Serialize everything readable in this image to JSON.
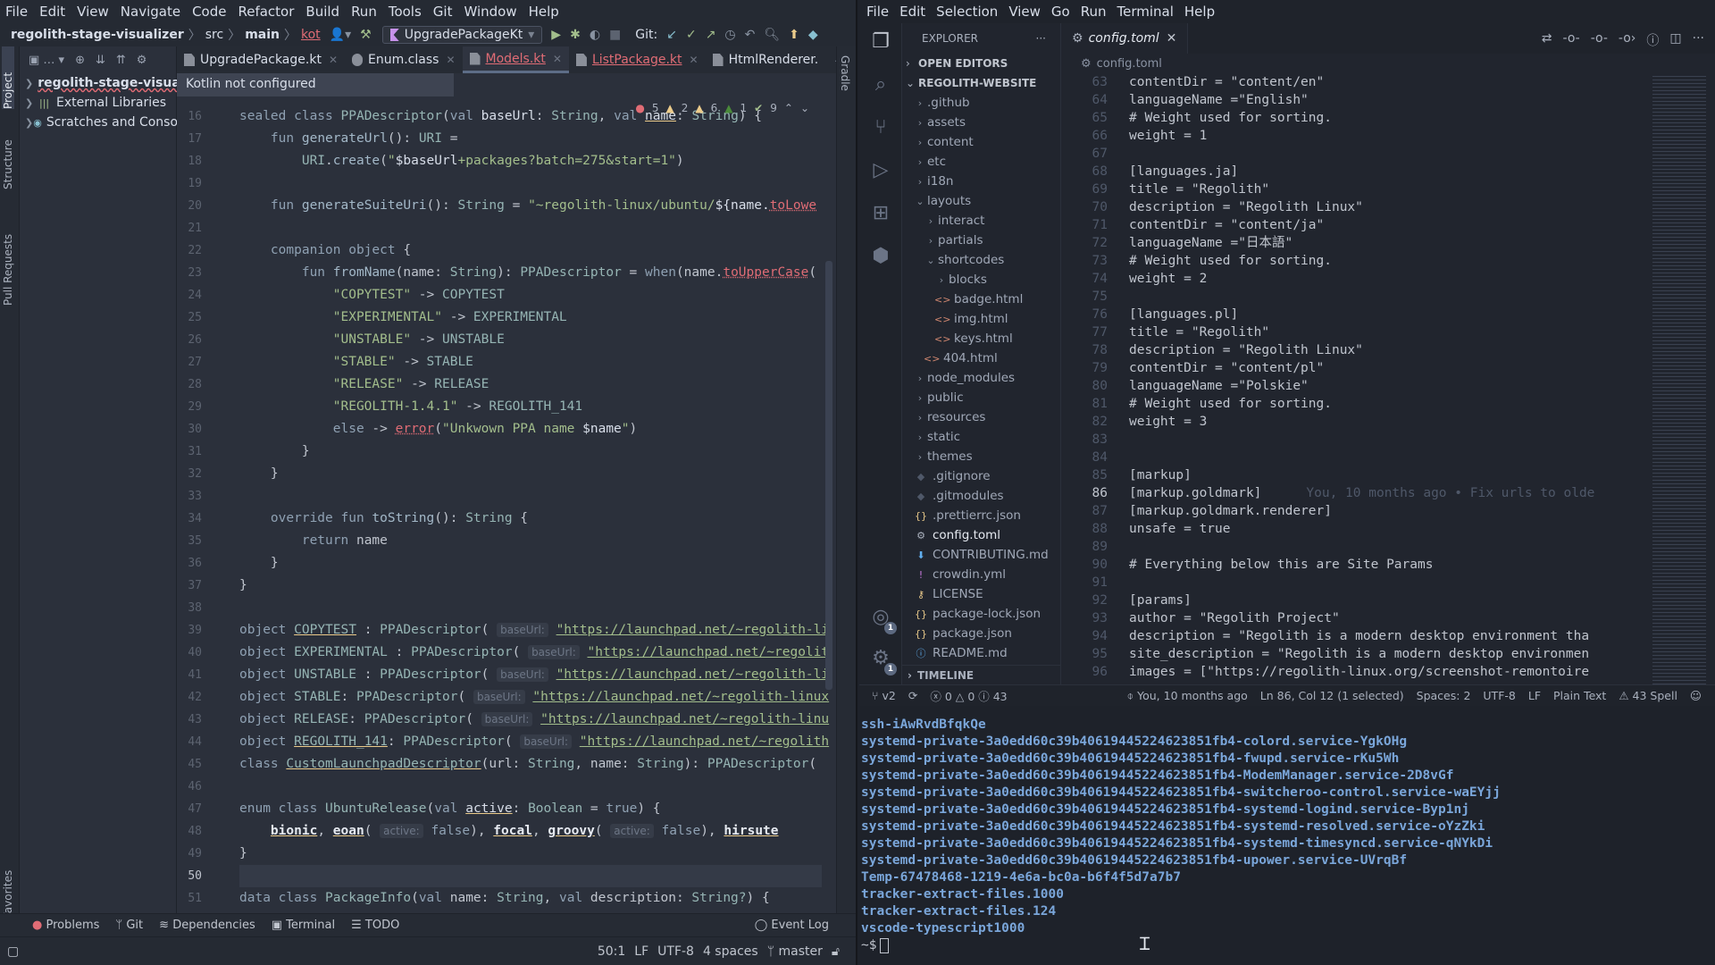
{
  "intellij": {
    "menu": [
      "File",
      "Edit",
      "View",
      "Navigate",
      "Code",
      "Refactor",
      "Build",
      "Run",
      "Tools",
      "Git",
      "Window",
      "Help"
    ],
    "breadcrumb": {
      "project": "regolith-stage-visualizer",
      "src": "src",
      "main": "main",
      "kot": "kot"
    },
    "run_config": "UpgradePackageKt",
    "git_label": "Git:",
    "left_tool_tabs": [
      "Project",
      "Structure",
      "Pull Requests",
      "Favorites"
    ],
    "right_tool_tabs": [
      "Gradle"
    ],
    "project_tree": [
      {
        "label": "regolith-stage-visualizer",
        "type": "module"
      },
      {
        "label": "External Libraries",
        "type": "libraries"
      },
      {
        "label": "Scratches and Consoles",
        "type": "scratches"
      }
    ],
    "tabs": [
      {
        "label": "UpgradePackage.kt",
        "error": false,
        "active": false
      },
      {
        "label": "Enum.class",
        "error": false,
        "active": false
      },
      {
        "label": "Models.kt",
        "error": true,
        "active": true
      },
      {
        "label": "ListPackage.kt",
        "error": true,
        "active": false
      },
      {
        "label": "HtmlRenderer.",
        "error": false,
        "active": false
      }
    ],
    "tooltip": "Kotlin not configured",
    "inspections": {
      "errors": "5",
      "warnings": "2",
      "weak_warnings": "6",
      "typos": "1",
      "ok": "9"
    },
    "code_lines": [
      {
        "n": "16",
        "html": "<span class='kw'>sealed class</span> <span class='ty'>PPADescriptor</span>(<span class='kw'>val</span> <span class='nm'>baseUrl</span>: <span class='ty'>String</span>, <span class='kw'>val</span> <span class='nm yu'>name</span>: <span class='ty'>String</span>) {"
      },
      {
        "n": "17",
        "html": "    <span class='kw'>fun</span> <span class='fn'>generateUrl</span>(): <span class='ty'>URI</span> ="
      },
      {
        "n": "18",
        "html": "        <span class='ty'>URI</span>.<span class='fn'>create</span>(<span class='st'>\"</span><span class='nm'>$baseUrl</span><span class='st'>+packages?batch=275&amp;start=1\"</span>)"
      },
      {
        "n": "19",
        "html": ""
      },
      {
        "n": "20",
        "html": "    <span class='kw'>fun</span> <span class='fn'>generateSuiteUri</span>(): <span class='ty'>String</span> = <span class='st'>\"~regolith-linux/ubuntu/</span><span class='nm'>${name.</span><span class='redu'>toLowe</span>"
      },
      {
        "n": "21",
        "html": ""
      },
      {
        "n": "22",
        "html": "    <span class='kw'>companion object</span> {"
      },
      {
        "n": "23",
        "html": "        <span class='kw'>fun</span> <span class='fn'>fromName</span>(name: <span class='ty'>String</span>): <span class='ty'>PPADescriptor</span> = <span class='kw'>when</span>(name.<span class='redu'>toUpperCase</span>("
      },
      {
        "n": "24",
        "html": "            <span class='st'>\"COPYTEST\"</span> -&gt; <span class='ty'>COPYTEST</span>"
      },
      {
        "n": "25",
        "html": "            <span class='st'>\"EXPERIMENTAL\"</span> -&gt; <span class='ty'>EXPERIMENTAL</span>"
      },
      {
        "n": "26",
        "html": "            <span class='st'>\"UNSTABLE\"</span> -&gt; <span class='ty'>UNSTABLE</span>"
      },
      {
        "n": "27",
        "html": "            <span class='st'>\"STABLE\"</span> -&gt; <span class='ty'>STABLE</span>"
      },
      {
        "n": "28",
        "html": "            <span class='st'>\"RELEASE\"</span> -&gt; <span class='ty'>RELEASE</span>"
      },
      {
        "n": "29",
        "html": "            <span class='st'>\"REGOLITH-1.4.1\"</span> -&gt; <span class='ty'>REGOLITH_141</span>"
      },
      {
        "n": "30",
        "html": "            <span class='kw'>else</span> -&gt; <span class='redu'>error</span>(<span class='st'>\"Unkwown PPA name </span><span class='nm'>$name</span><span class='st'>\"</span>)"
      },
      {
        "n": "31",
        "html": "        }"
      },
      {
        "n": "32",
        "html": "    }"
      },
      {
        "n": "33",
        "html": ""
      },
      {
        "n": "34",
        "html": "    <span class='kw'>override fun</span> <span class='fn'>toString</span>(): <span class='ty'>String</span> {"
      },
      {
        "n": "35",
        "html": "        <span class='kw'>return</span> name"
      },
      {
        "n": "36",
        "html": "    }"
      },
      {
        "n": "37",
        "html": "}"
      },
      {
        "n": "38",
        "html": ""
      },
      {
        "n": "39",
        "html": "<span class='kw'>object</span> <span class='ty yu'>COPYTEST</span> : <span class='ty'>PPADescriptor</span>( <span class='hint'>baseUrl:</span> <span class='url'>\"https://launchpad.net/~regolith-li</span>"
      },
      {
        "n": "40",
        "html": "<span class='kw'>object</span> <span class='ty'>EXPERIMENTAL</span> : <span class='ty'>PPADescriptor</span>( <span class='hint'>baseUrl:</span> <span class='url'>\"https://launchpad.net/~regolit</span>"
      },
      {
        "n": "41",
        "html": "<span class='kw'>object</span> <span class='ty'>UNSTABLE</span> : <span class='ty'>PPADescriptor</span>( <span class='hint'>baseUrl:</span> <span class='url'>\"https://launchpad.net/~regolith-li</span>"
      },
      {
        "n": "42",
        "html": "<span class='kw'>object</span> <span class='ty'>STABLE</span>: <span class='ty'>PPADescriptor</span>( <span class='hint'>baseUrl:</span> <span class='url'>\"https://launchpad.net/~regolith-linux</span>"
      },
      {
        "n": "43",
        "html": "<span class='kw'>object</span> <span class='ty'>RELEASE</span>: <span class='ty'>PPADescriptor</span>( <span class='hint'>baseUrl:</span> <span class='url'>\"https://launchpad.net/~regolith-linu</span>"
      },
      {
        "n": "44",
        "html": "<span class='kw'>object</span> <span class='ty yu'>REGOLITH_141</span>: <span class='ty'>PPADescriptor</span>( <span class='hint'>baseUrl:</span> <span class='url'>\"https://launchpad.net/~regolith</span>"
      },
      {
        "n": "45",
        "html": "<span class='kw'>class</span> <span class='ty yu'>CustomLaunchpadDescriptor</span>(url: <span class='ty'>String</span>, name: <span class='ty'>String</span>): <span class='ty'>PPADescriptor</span>("
      },
      {
        "n": "46",
        "html": ""
      },
      {
        "n": "47",
        "html": "<span class='kw'>enum class</span> <span class='ty'>UbuntuRelease</span>(<span class='kw'>val</span> <span class='nm yu'>active</span>: <span class='ty'>Boolean</span> = <span class='kw'>true</span>) {"
      },
      {
        "n": "48",
        "html": "    <span class='bold yu'>bionic</span>, <span class='bold yu'>eoan</span>( <span class='hint'>active:</span> <span class='kw'>false</span>), <span class='bold yu'>focal</span>, <span class='bold yu'>groovy</span>( <span class='hint'>active:</span> <span class='kw'>false</span>), <span class='bold yu'>hirsute</span>"
      },
      {
        "n": "49",
        "html": "}"
      },
      {
        "n": "50",
        "html": "",
        "current": true
      },
      {
        "n": "51",
        "html": "<span class='kw'>data class</span> <span class='ty'>PackageInfo</span>(<span class='kw'>val</span> name: <span class='ty'>String</span>, <span class='kw'>val</span> description: <span class='ty'>String?</span>) {"
      }
    ],
    "bottom_tools": [
      "Problems",
      "Git",
      "Dependencies",
      "Terminal",
      "TODO"
    ],
    "event_log": "Event Log",
    "status": {
      "position": "50:1",
      "line_sep": "LF",
      "encoding": "UTF-8",
      "indent": "4 spaces",
      "branch": "master"
    }
  },
  "vscode": {
    "menu": [
      "File",
      "Edit",
      "Selection",
      "View",
      "Go",
      "Run",
      "Terminal",
      "Help"
    ],
    "explorer_title": "EXPLORER",
    "open_editors": "OPEN EDITORS",
    "workspace": "REGOLITH-WEBSITE",
    "files": [
      {
        "label": ".github",
        "kind": "folder",
        "depth": 0,
        "open": false
      },
      {
        "label": "assets",
        "kind": "folder",
        "depth": 0,
        "open": false
      },
      {
        "label": "content",
        "kind": "folder",
        "depth": 0,
        "open": false
      },
      {
        "label": "etc",
        "kind": "folder",
        "depth": 0,
        "open": false
      },
      {
        "label": "i18n",
        "kind": "folder",
        "depth": 0,
        "open": false
      },
      {
        "label": "layouts",
        "kind": "folder",
        "depth": 0,
        "open": true
      },
      {
        "label": "interact",
        "kind": "folder",
        "depth": 1,
        "open": false
      },
      {
        "label": "partials",
        "kind": "folder",
        "depth": 1,
        "open": false
      },
      {
        "label": "shortcodes",
        "kind": "folder",
        "depth": 1,
        "open": true
      },
      {
        "label": "blocks",
        "kind": "folder",
        "depth": 2,
        "open": false
      },
      {
        "label": "badge.html",
        "kind": "html",
        "depth": 2
      },
      {
        "label": "img.html",
        "kind": "html",
        "depth": 2
      },
      {
        "label": "keys.html",
        "kind": "html",
        "depth": 2
      },
      {
        "label": "404.html",
        "kind": "html",
        "depth": 1
      },
      {
        "label": "node_modules",
        "kind": "folder",
        "depth": 0,
        "open": false
      },
      {
        "label": "public",
        "kind": "folder",
        "depth": 0,
        "open": false
      },
      {
        "label": "resources",
        "kind": "folder",
        "depth": 0,
        "open": false
      },
      {
        "label": "static",
        "kind": "folder",
        "depth": 0,
        "open": false
      },
      {
        "label": "themes",
        "kind": "folder",
        "depth": 0,
        "open": false
      },
      {
        "label": ".gitignore",
        "kind": "git",
        "depth": 0
      },
      {
        "label": ".gitmodules",
        "kind": "git",
        "depth": 0
      },
      {
        "label": ".prettierrc.json",
        "kind": "json",
        "depth": 0
      },
      {
        "label": "config.toml",
        "kind": "toml",
        "depth": 0,
        "selected": true
      },
      {
        "label": "CONTRIBUTING.md",
        "kind": "md",
        "depth": 0
      },
      {
        "label": "crowdin.yml",
        "kind": "yml",
        "depth": 0
      },
      {
        "label": "LICENSE",
        "kind": "license",
        "depth": 0
      },
      {
        "label": "package-lock.json",
        "kind": "json",
        "depth": 0
      },
      {
        "label": "package.json",
        "kind": "json",
        "depth": 0
      },
      {
        "label": "README.md",
        "kind": "info",
        "depth": 0
      }
    ],
    "timeline": "TIMELINE",
    "tab": "config.toml",
    "breadcrumb": "config.toml",
    "code_lines": [
      {
        "n": "63",
        "text": "contentDir = \"content/en\""
      },
      {
        "n": "64",
        "text": "languageName =\"English\""
      },
      {
        "n": "65",
        "text": "# Weight used for sorting."
      },
      {
        "n": "66",
        "text": "weight = 1"
      },
      {
        "n": "67",
        "text": ""
      },
      {
        "n": "68",
        "text": "[languages.ja]"
      },
      {
        "n": "69",
        "text": "title = \"Regolith\""
      },
      {
        "n": "70",
        "text": "description = \"Regolith Linux\""
      },
      {
        "n": "71",
        "text": "contentDir = \"content/ja\""
      },
      {
        "n": "72",
        "text": "languageName =\"日本語\""
      },
      {
        "n": "73",
        "text": "# Weight used for sorting."
      },
      {
        "n": "74",
        "text": "weight = 2"
      },
      {
        "n": "75",
        "text": ""
      },
      {
        "n": "76",
        "text": "[languages.pl]"
      },
      {
        "n": "77",
        "text": "title = \"Regolith\""
      },
      {
        "n": "78",
        "text": "description = \"Regolith Linux\""
      },
      {
        "n": "79",
        "text": "contentDir = \"content/pl\""
      },
      {
        "n": "80",
        "text": "languageName =\"Polskie\""
      },
      {
        "n": "81",
        "text": "# Weight used for sorting."
      },
      {
        "n": "82",
        "text": "weight = 3"
      },
      {
        "n": "83",
        "text": ""
      },
      {
        "n": "84",
        "text": ""
      },
      {
        "n": "85",
        "text": "[markup]"
      },
      {
        "n": "86",
        "text": "[markup.goldmark]",
        "current": true,
        "blame": "You, 10 months ago • Fix urls to olde"
      },
      {
        "n": "87",
        "text": "[markup.goldmark.renderer]"
      },
      {
        "n": "88",
        "text": "unsafe = true"
      },
      {
        "n": "89",
        "text": ""
      },
      {
        "n": "90",
        "text": "# Everything below this are Site Params"
      },
      {
        "n": "91",
        "text": ""
      },
      {
        "n": "92",
        "text": "[params]"
      },
      {
        "n": "93",
        "text": "author = \"Regolith Project\""
      },
      {
        "n": "94",
        "text": "description = \"Regolith is a modern desktop environment tha"
      },
      {
        "n": "95",
        "text": "site_description = \"Regolith is a modern desktop environmen"
      },
      {
        "n": "96",
        "text": "images = [\"https://regolith-linux.org/screenshot-remontoire"
      }
    ],
    "status": {
      "branch": "v2",
      "errors": "0",
      "warnings": "0",
      "infos": "43",
      "blame": "You, 10 months ago",
      "cursor": "Ln 86, Col 12 (1 selected)",
      "spaces": "Spaces: 2",
      "encoding": "UTF-8",
      "eol": "LF",
      "language": "Plain Text",
      "spell": "43 Spell"
    }
  },
  "terminal": {
    "lines": [
      "ssh-iAwRvdBfqkQe",
      "systemd-private-3a0edd60c39b40619445224623851fb4-colord.service-YgkOHg",
      "systemd-private-3a0edd60c39b40619445224623851fb4-fwupd.service-rKu5Wh",
      "systemd-private-3a0edd60c39b40619445224623851fb4-ModemManager.service-2D8vGf",
      "systemd-private-3a0edd60c39b40619445224623851fb4-switcheroo-control.service-waEYjj",
      "systemd-private-3a0edd60c39b40619445224623851fb4-systemd-logind.service-Byp1nj",
      "systemd-private-3a0edd60c39b40619445224623851fb4-systemd-resolved.service-oYzZki",
      "systemd-private-3a0edd60c39b40619445224623851fb4-systemd-timesyncd.service-qNYkDi",
      "systemd-private-3a0edd60c39b40619445224623851fb4-upower.service-UVrqBf",
      "Temp-67478468-1219-4e6a-bc0a-b6f4f5d7a7b7",
      "tracker-extract-files.1000",
      "tracker-extract-files.124",
      "vscode-typescript1000"
    ],
    "prompt": "~$"
  }
}
